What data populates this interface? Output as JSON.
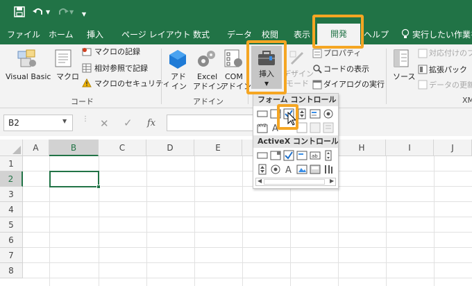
{
  "qat": {
    "save_icon": "save-icon",
    "undo_icon": "undo-icon",
    "redo_icon": "redo-icon",
    "customize_icon": "chevron-down-icon"
  },
  "tabs": [
    {
      "label": "ファイル"
    },
    {
      "label": "ホーム"
    },
    {
      "label": "挿入"
    },
    {
      "label": "ページ レイアウト"
    },
    {
      "label": "数式"
    },
    {
      "label": "データ"
    },
    {
      "label": "校閲"
    },
    {
      "label": "表示"
    },
    {
      "label": "開発"
    },
    {
      "label": "ヘルプ"
    }
  ],
  "tell_me": "実行したい作業を",
  "ribbon": {
    "code": {
      "label": "コード",
      "visual_basic": "Visual Basic",
      "macro": "マクロ",
      "record_macro": "マクロの記録",
      "relative_ref": "相対参照で記録",
      "macro_security": "マクロのセキュリティ"
    },
    "addins": {
      "label": "アドイン",
      "addin": [
        "アド",
        "イン"
      ],
      "excel_addin": [
        "Excel",
        "アドイン"
      ],
      "com_addin": [
        "COM",
        "アドイン"
      ]
    },
    "controls": {
      "insert": "挿入",
      "design": [
        "デザイン",
        "モード"
      ],
      "properties": "プロパティ",
      "view_code": "コードの表示",
      "dialog": "ダイアログの実行"
    },
    "xml": {
      "source": "ソース",
      "map_props": "対応付けのプ",
      "expansion_pack": "拡張パック",
      "refresh": "データの更新",
      "label": "XM"
    }
  },
  "formula_bar": {
    "name_box": "B2",
    "fx": "fx"
  },
  "dropdown": {
    "form_controls": "フォーム コントロール",
    "activex_controls": "ActiveX コントロール"
  },
  "grid": {
    "columns": [
      "A",
      "B",
      "C",
      "D",
      "E",
      "F",
      "G",
      "H",
      "I",
      "J"
    ],
    "rows": [
      "1",
      "2",
      "3",
      "4",
      "5",
      "6",
      "7",
      "8"
    ]
  },
  "colors": {
    "excel_green": "#217346",
    "highlight_orange": "#f5a623",
    "ribbon_bg": "#f3f3f3"
  }
}
